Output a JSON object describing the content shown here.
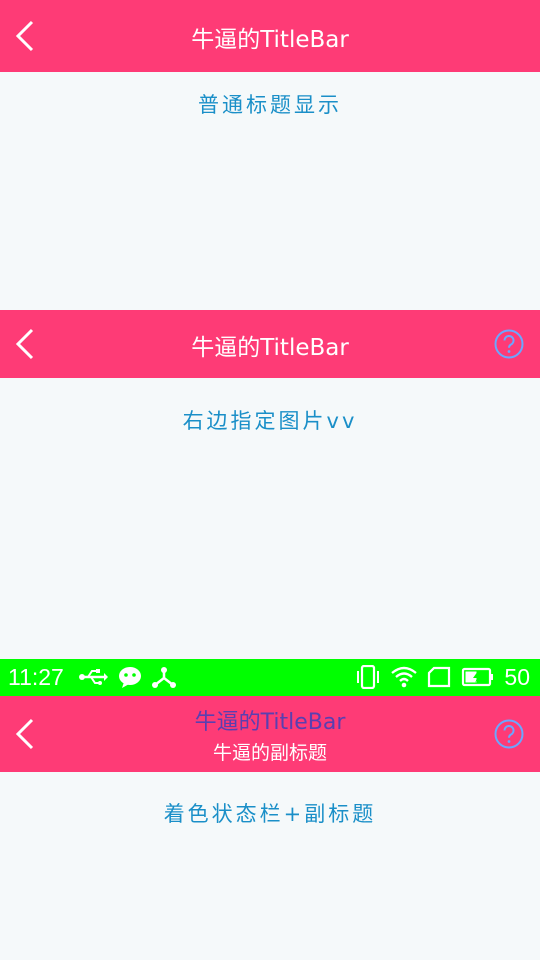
{
  "section1": {
    "title": "牛逼的TitleBar",
    "content": "普通标题显示"
  },
  "section2": {
    "title": "牛逼的TitleBar",
    "content": "右边指定图片vv"
  },
  "statusbar": {
    "time": "11:27",
    "battery": "50",
    "color": "#00ff00"
  },
  "section3": {
    "title": "牛逼的TitleBar",
    "subtitle": "牛逼的副标题",
    "content": "着色状态栏+副标题"
  },
  "colors": {
    "titlebar": "#fe3b76",
    "content_text": "#1a8fc8",
    "help_icon": "#6aa7ff",
    "background": "#f5f9fa"
  },
  "icons": [
    "back-icon",
    "help-icon",
    "usb-icon",
    "wechat-icon",
    "share-icon",
    "vibrate-icon",
    "wifi-icon",
    "sim-icon",
    "battery-icon"
  ]
}
